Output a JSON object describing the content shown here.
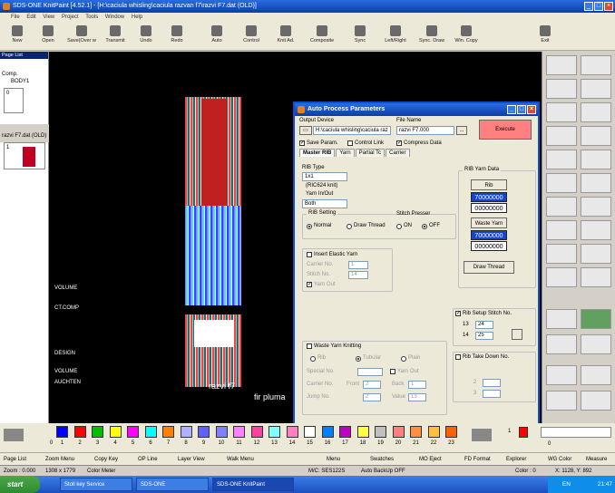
{
  "window": {
    "title": "SDS-ONE KnitPaint [4.52.1] - [H:\\caciula whisling\\caciula razvan f7\\razvi F7.dat (OLD)]"
  },
  "menu": [
    "File",
    "Edit",
    "View",
    "Project",
    "Tools",
    "Window",
    "Help"
  ],
  "toolbar": [
    "New",
    "Open",
    "Save(Over w",
    "Transmit",
    "Undo",
    "Redo",
    "Auto",
    "Control",
    "Knit Ad.",
    "Composite",
    "Sync",
    "Left/Right",
    "Sync. Draw",
    "Win. Copy",
    "Exit"
  ],
  "left_panel": {
    "page_list_title": "Page List",
    "comp_label": "Comp.",
    "body_label": "BODY1",
    "item_index": "0",
    "file_label": "razvi F7.dat (OLD)",
    "file_index": "1"
  },
  "canvas": {
    "label1": "razvi f7",
    "label2": "fir pluma",
    "left_labels": [
      "VOLUME",
      "CT.COMP",
      "DESIGN",
      "VOLUME",
      "AUCHTEN"
    ]
  },
  "dialog": {
    "title": "Auto Process Parameters",
    "output_device_label": "Output Device",
    "output_device_path": "H:\\caciula whisling\\caciula raz",
    "file_name_label": "File Name",
    "file_name_value": "razvi F7.000",
    "browse_label": "...",
    "execute_label": "Execute",
    "save_param_label": "Save Param.",
    "control_link_label": "Control Link",
    "compress_data_label": "Compress Data",
    "tabs": [
      "Master RIB",
      "Yarn",
      "Partial Tc",
      "Carrier"
    ],
    "rib_type_label": "RIB Type",
    "rib_type_value": "1x1",
    "rib_note": "(RIC624 knit)",
    "yarn_inout_label": "Yarn In/Out",
    "yarn_inout_value": "Both",
    "rib_setting_label": "RIB Setting",
    "normal_label": "Normal",
    "draw_thread_radio": "Draw Thread",
    "stitch_presser_label": "Stitch Presser",
    "on_label": "ON",
    "off_label": "OFF",
    "insert_elastic_label": "Insert Elastic Yarn",
    "carrier_no_label": "Carrier No.",
    "carrier_no_value": "1",
    "stitch_no_label": "Stitch No.",
    "stitch_no_value": "14",
    "yarn_out_label": "Yarn Out",
    "rib_yarn_data_label": "RIB Yarn Data",
    "rib_button": "Rib",
    "rib_value1": "70000000",
    "rib_value2": "00000000",
    "waste_yarn_button": "Waste Yarn",
    "waste_value1": "70000000",
    "waste_value2": "00000000",
    "draw_thread_button": "Draw Thread",
    "rib_setup_label": "Rib Setup Stitch No.",
    "rib_setup_13": "13",
    "rib_setup_13_value": "24",
    "rib_setup_14": "14",
    "rib_setup_14_value": "25",
    "rib_takedown_label": "Rib Take Down No.",
    "td_1": "2",
    "td_2": "3",
    "waste_knitting_label": "Waste Yarn Knitting",
    "wk_rib": "Rib",
    "wk_tubular": "Tubular",
    "wk_plain": "Plain",
    "special_no_label": "Special No.",
    "wk_yarn_out": "Yarn Out",
    "wk_carrier_label": "Carrier No.",
    "front_label": "Front",
    "back_label": "Back",
    "front_value": "2",
    "back_value": "1",
    "jump_no_label": "Jump No.",
    "values_label": "Value",
    "jump_value": "2",
    "value_value": "13"
  },
  "colors": {
    "swatches": [
      "#0000ff",
      "#ff0000",
      "#00c000",
      "#ffff00",
      "#ff00ff",
      "#00ffff",
      "#ff8000",
      "#b0b0ff",
      "#6060ff",
      "#8080ff",
      "#ff80ff",
      "#ff40a0",
      "#80ffff",
      "#ff80c0",
      "#ffffff",
      "#0080ff",
      "#c000c0",
      "#ffff40",
      "#c0c0c0",
      "#ff8080",
      "#ff9040",
      "#ffc040",
      "#ff6000",
      "#ff6000"
    ],
    "numbers": [
      "1",
      "2",
      "3",
      "4",
      "5",
      "6",
      "7",
      "8",
      "9",
      "10",
      "11",
      "12",
      "13",
      "14",
      "15",
      "16",
      "17",
      "18",
      "19",
      "20",
      "21",
      "22",
      "23"
    ],
    "first_number": "0",
    "spin_value": "1",
    "zero_label": "0"
  },
  "bottom_toolbar": [
    "Page List",
    "Zoom Menu",
    "Copy Key",
    "OP Line",
    "Layer View",
    "Walk Menu",
    "Menu",
    "Swatches",
    "MO Eject",
    "FD Format",
    "Explorer",
    "WG Color",
    "Measure"
  ],
  "status": {
    "zoom": "Zoom : 0.000",
    "size": "1308 x 1779",
    "color_meter": "Color Meter",
    "mc": "M/C: SES122S",
    "backup": "Auto BackUp OFF",
    "color": "Color : 0",
    "coords": "X: 1128, Y: 892"
  },
  "taskbar": {
    "start": "start",
    "items": [
      "Stoll key Service",
      "SDS-ONE",
      "SDS-ONE KnitPaint"
    ],
    "tray_lang": "EN",
    "time": "21:47"
  }
}
